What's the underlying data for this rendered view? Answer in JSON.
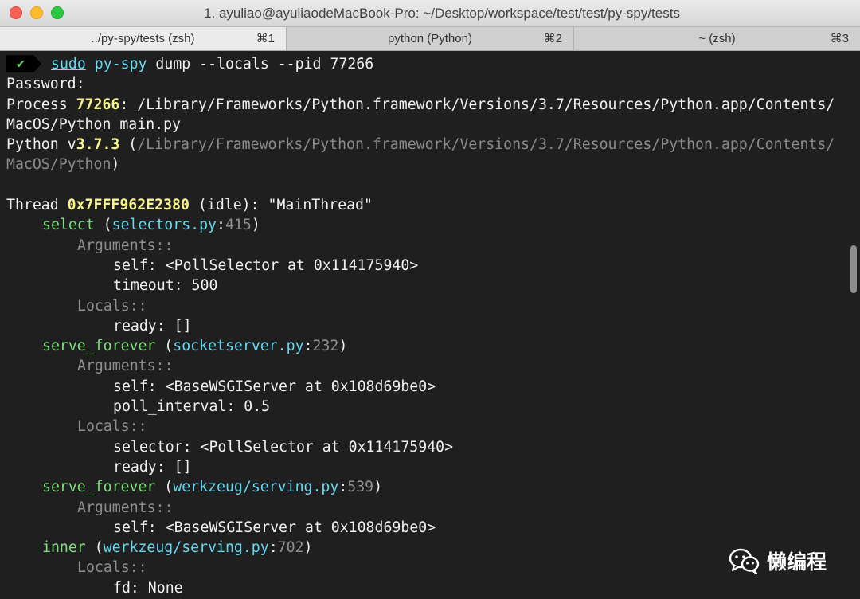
{
  "window": {
    "title": "1. ayuliao@ayuliaodeMacBook-Pro: ~/Desktop/workspace/test/test/py-spy/tests"
  },
  "tabs": [
    {
      "label": "../py-spy/tests (zsh)",
      "shortcut": "⌘1",
      "active": true
    },
    {
      "label": "python (Python)",
      "shortcut": "⌘2",
      "active": false
    },
    {
      "label": "~ (zsh)",
      "shortcut": "⌘3",
      "active": false
    }
  ],
  "terminal": {
    "prompt_icon": "checkmark-icon",
    "cmd_sudo": "sudo",
    "cmd_tool": "py-spy",
    "cmd_args": " dump --locals --pid 77266",
    "password": "Password:",
    "process_prefix": "Process ",
    "process_pid": "77266",
    "process_path_1": ": /Library/Frameworks/Python.framework/Versions/3.7/Resources/Python.app/Contents/",
    "process_path_2": "MacOS/Python main.py",
    "python_prefix": "Python v",
    "python_version": "3.7.3",
    "python_paren_open": " (",
    "python_path_1": "/Library/Frameworks/Python.framework/Versions/3.7/Resources/Python.app/Contents/",
    "python_path_2": "MacOS/Python",
    "python_paren_close": ")",
    "thread_prefix": "Thread ",
    "thread_id": "0x7FFF962E2380",
    "thread_suffix": " (idle): \"MainThread\"",
    "frames": [
      {
        "func": "select",
        "file": "selectors.py",
        "line": "415",
        "arguments": [
          "self: <PollSelector at 0x114175940>",
          "timeout: 500"
        ],
        "locals": [
          "ready: []"
        ]
      },
      {
        "func": "serve_forever",
        "file": "socketserver.py",
        "line": "232",
        "arguments": [
          "self: <BaseWSGIServer at 0x108d69be0>",
          "poll_interval: 0.5"
        ],
        "locals": [
          "selector: <PollSelector at 0x114175940>",
          "ready: []"
        ]
      },
      {
        "func": "serve_forever",
        "file": "werkzeug/serving.py",
        "line": "539",
        "arguments": [
          "self: <BaseWSGIServer at 0x108d69be0>"
        ],
        "locals": []
      },
      {
        "func": "inner",
        "file": "werkzeug/serving.py",
        "line": "702",
        "arguments": [],
        "locals": [
          "fd: None"
        ]
      }
    ],
    "arguments_label": "Arguments::",
    "locals_label": "Locals::"
  },
  "watermark": {
    "text": "懒编程",
    "icon": "wechat-icon"
  }
}
